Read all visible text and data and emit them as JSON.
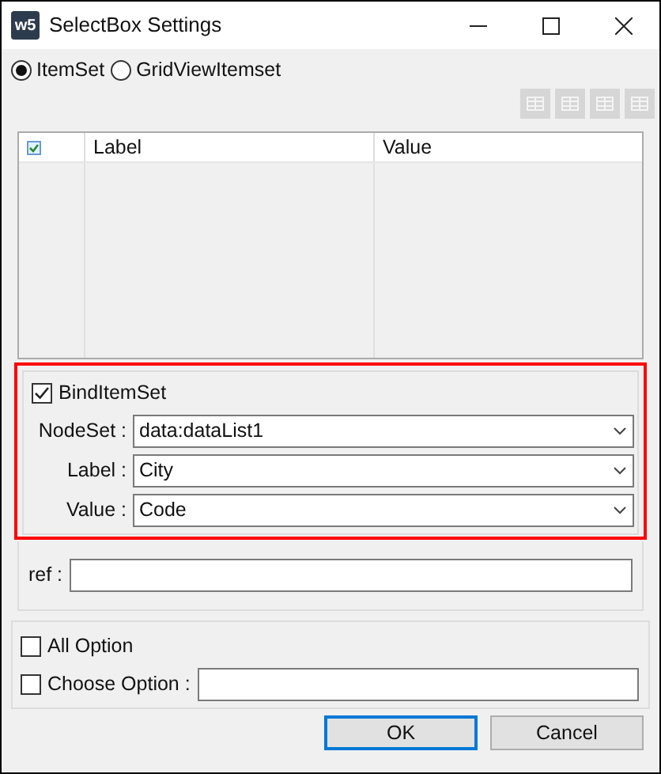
{
  "window": {
    "logo": "w5",
    "title": "SelectBox Settings"
  },
  "source_options": [
    {
      "label": "ItemSet",
      "selected": true
    },
    {
      "label": "GridViewItemset",
      "selected": false
    }
  ],
  "toolbar": [
    {
      "disabled": true
    },
    {
      "disabled": true
    },
    {
      "disabled": true
    },
    {
      "disabled": true
    }
  ],
  "table": {
    "header_checked": true,
    "columns": [
      "Label",
      "Value"
    ]
  },
  "bind": {
    "label": "BindItemSet",
    "checked": true,
    "fields": [
      {
        "label": "NodeSet :",
        "value": "data:dataList1"
      },
      {
        "label": "Label :",
        "value": "City"
      },
      {
        "label": "Value :",
        "value": "Code"
      }
    ]
  },
  "ref": {
    "label": "ref :"
  },
  "options": [
    {
      "label": "All Option",
      "checked": false,
      "kind": "checkbox"
    },
    {
      "label": "Choose Option :",
      "checked": false,
      "kind": "checkbox-field"
    }
  ],
  "buttons": [
    {
      "label": "OK",
      "default": true
    },
    {
      "label": "Cancel",
      "default": false
    }
  ]
}
